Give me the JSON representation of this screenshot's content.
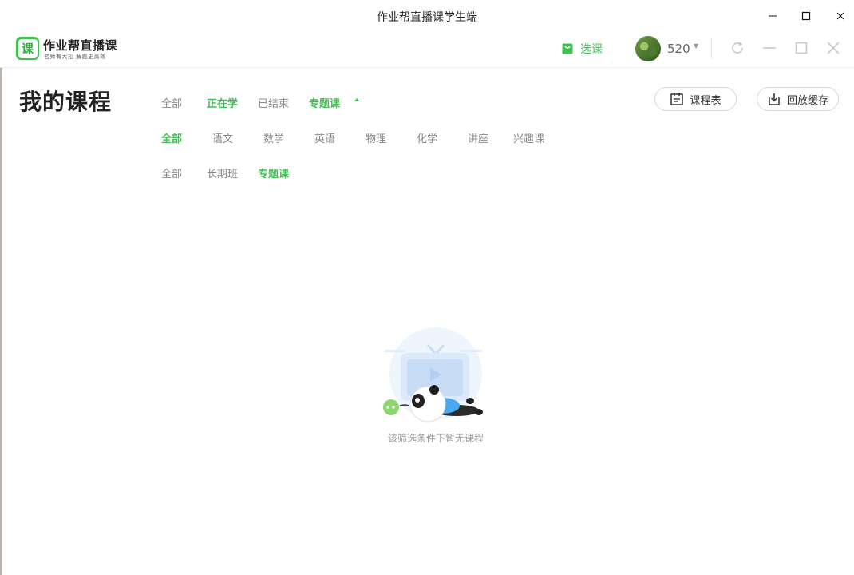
{
  "window": {
    "title": "作业帮直播课学生端",
    "minimize_icon": "minimize-icon",
    "maximize_icon": "maximize-icon",
    "close_icon": "close-icon"
  },
  "header": {
    "logo_char": "课",
    "brand_name": "作业帮直播课",
    "slogan": "名师有大招 解题更高效",
    "select_course_label": "选课",
    "username": "520",
    "refresh_icon": "refresh-icon",
    "minimize_icon": "minimize-icon",
    "restore_icon": "restore-icon",
    "close_icon": "close-icon"
  },
  "main": {
    "page_title": "我的课程",
    "status_tabs": [
      {
        "label": "全部",
        "active": false
      },
      {
        "label": "正在学",
        "active": true
      },
      {
        "label": "已结束",
        "active": false
      },
      {
        "label": "专题课",
        "active": true
      }
    ],
    "subject_tabs": [
      {
        "label": "全部",
        "active": true
      },
      {
        "label": "语文",
        "active": false
      },
      {
        "label": "数学",
        "active": false
      },
      {
        "label": "英语",
        "active": false
      },
      {
        "label": "物理",
        "active": false
      },
      {
        "label": "化学",
        "active": false
      },
      {
        "label": "讲座",
        "active": false
      },
      {
        "label": "兴趣课",
        "active": false
      }
    ],
    "type_tabs": [
      {
        "label": "全部",
        "active": false
      },
      {
        "label": "长期班",
        "active": false
      },
      {
        "label": "专题课",
        "active": true
      }
    ],
    "schedule_button": "课程表",
    "download_button": "回放缓存",
    "empty_text": "该筛选条件下暂无课程"
  },
  "colors": {
    "accent": "#3fbf52",
    "text": "#222222",
    "muted": "#888888"
  }
}
